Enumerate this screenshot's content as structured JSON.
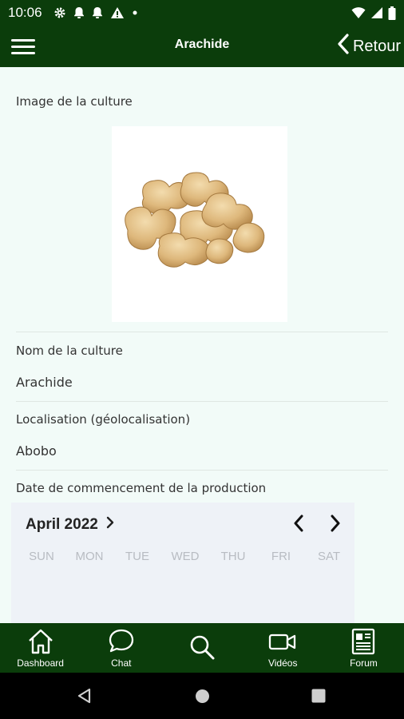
{
  "status_bar": {
    "time": "10:06",
    "left_icons": [
      "gear-icon",
      "bell-icon",
      "bell-icon",
      "warning-icon",
      "dot-icon"
    ],
    "right_icons": [
      "wifi-icon",
      "signal-icon",
      "battery-icon"
    ]
  },
  "app_bar": {
    "title": "Arachide",
    "back_label": "Retour"
  },
  "form": {
    "image_label": "Image de la culture",
    "name_label": "Nom de la culture",
    "name_value": "Arachide",
    "location_label": "Localisation (géolocalisation)",
    "location_value": "Abobo",
    "date_label": "Date de commencement de la production"
  },
  "calendar": {
    "month_year": "April 2022",
    "weekdays": [
      "SUN",
      "MON",
      "TUE",
      "WED",
      "THU",
      "FRI",
      "SAT"
    ]
  },
  "bottom_nav": {
    "items": [
      {
        "label": "Dashboard",
        "icon": "home-icon"
      },
      {
        "label": "Chat",
        "icon": "chat-icon"
      },
      {
        "label": "",
        "icon": "search-icon"
      },
      {
        "label": "Vidéos",
        "icon": "video-icon"
      },
      {
        "label": "Forum",
        "icon": "newspaper-icon"
      }
    ]
  },
  "colors": {
    "primary": "#0b3d0b",
    "background": "#f2fbf8",
    "calendar_bg": "#eef2f7"
  }
}
